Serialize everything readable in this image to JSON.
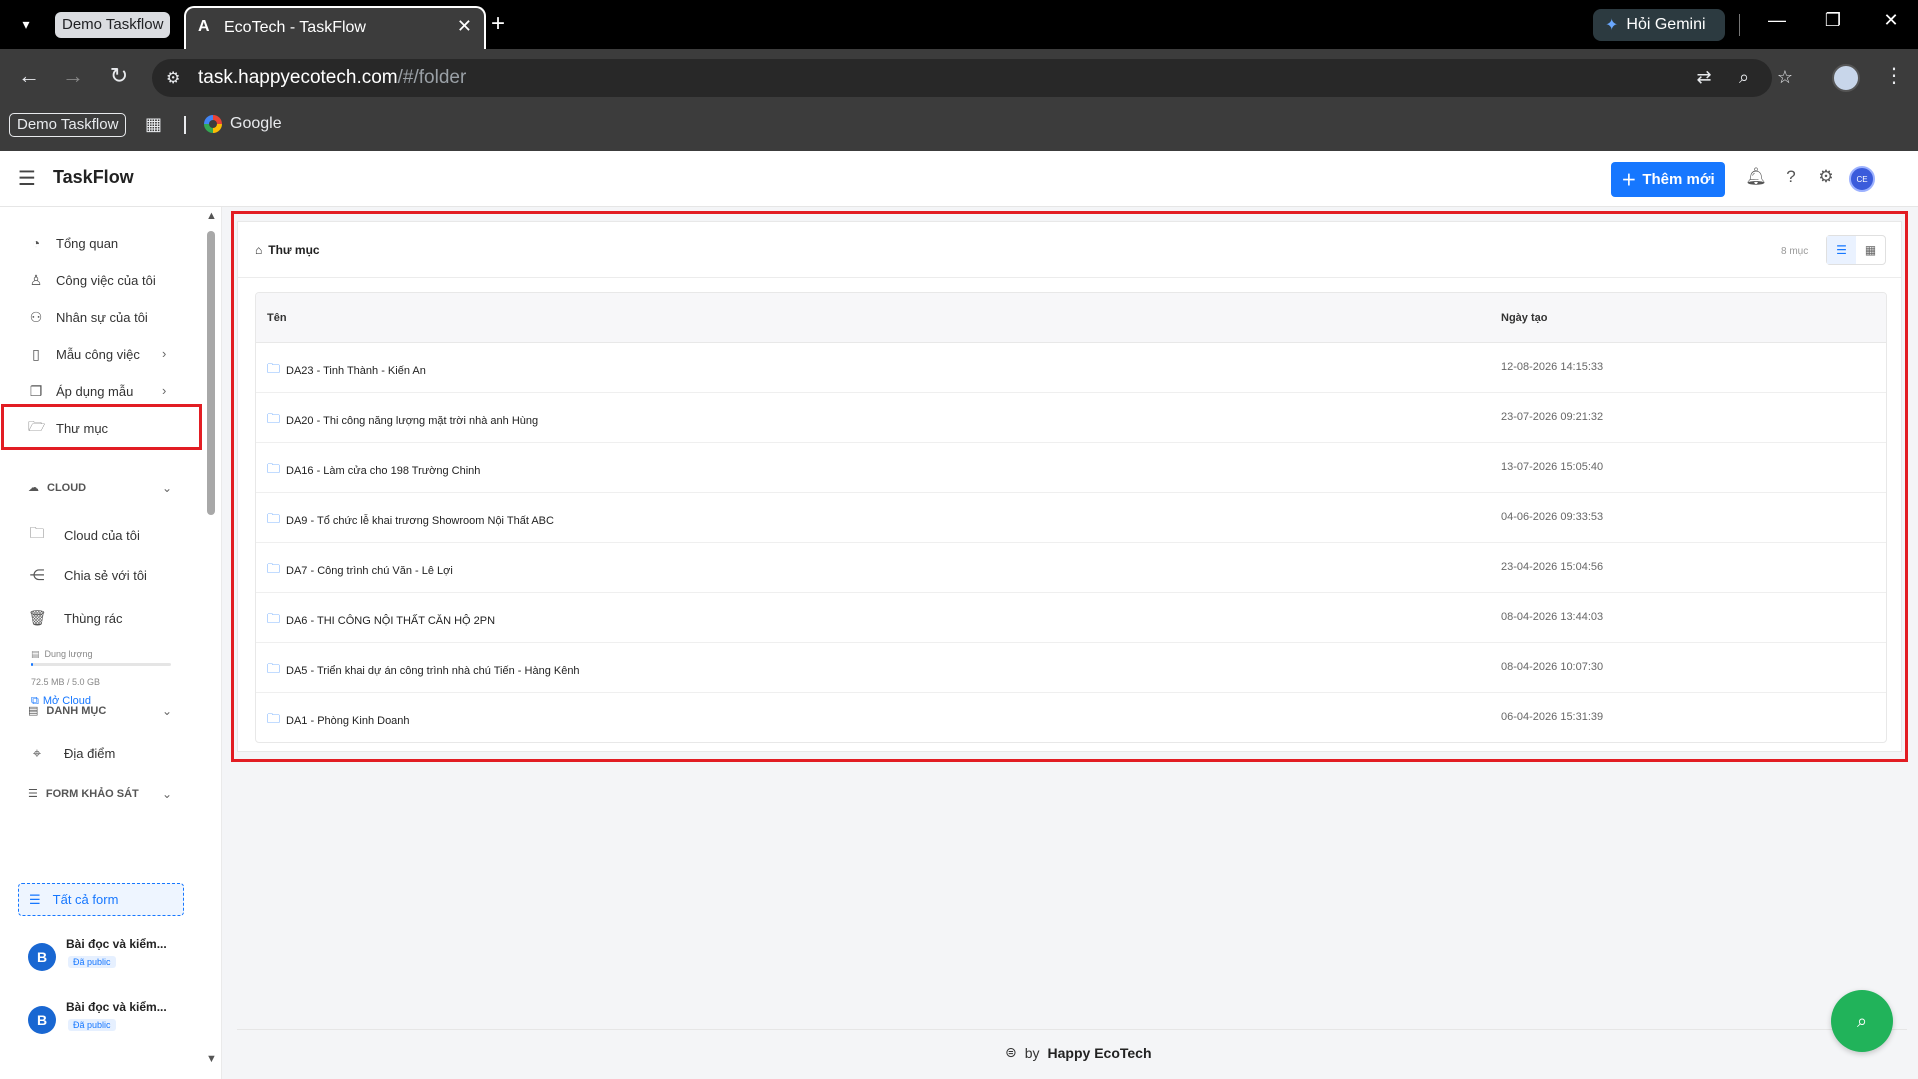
{
  "browser": {
    "tab_group": "Demo Taskflow",
    "active_tab_title": "EcoTech - TaskFlow",
    "new_tab": "+",
    "gemini_label": "Hỏi Gemini",
    "url_host": "task.happyecotech.com",
    "url_path": "/#/folder",
    "bookmark_chip": "Demo Taskflow",
    "bookmark_google": "Google"
  },
  "header": {
    "app_title": "TaskFlow",
    "add_button": "Thêm mới",
    "avatar_initials": "CE"
  },
  "sidebar": {
    "nav": [
      {
        "label": "Tổng quan",
        "icon": "dashboard-icon"
      },
      {
        "label": "Công việc của tôi",
        "icon": "user-icon"
      },
      {
        "label": "Nhân sự của tôi",
        "icon": "team-icon"
      },
      {
        "label": "Mẫu công việc",
        "icon": "file-icon"
      },
      {
        "label": "Áp dụng mẫu",
        "icon": "copy-icon"
      },
      {
        "label": "Thư mục",
        "icon": "folder-open-icon"
      }
    ],
    "cloud": {
      "heading": "CLOUD",
      "items": [
        {
          "label": "Cloud của tôi",
          "icon": "folder-icon"
        },
        {
          "label": "Chia sẻ với tôi",
          "icon": "share-icon"
        },
        {
          "label": "Thùng rác",
          "icon": "trash-icon"
        }
      ],
      "storage_label": "Dung lượng",
      "storage_text": "72.5 MB / 5.0 GB",
      "storage_fraction": 0.014,
      "open_cloud": "Mở Cloud"
    },
    "category": {
      "heading": "DANH MỤC",
      "items": [
        {
          "label": "Địa điểm",
          "icon": "location-icon"
        }
      ]
    },
    "forms": {
      "heading": "FORM KHẢO SÁT",
      "all_forms": "Tất cả form",
      "items": [
        {
          "avatar": "B",
          "title": "Bài đọc và kiểm...",
          "badge": "Đã public"
        },
        {
          "avatar": "B",
          "title": "Bài đọc và kiểm...",
          "badge": "Đã public"
        }
      ]
    }
  },
  "main": {
    "breadcrumb": "Thư mục",
    "count": "8 mục",
    "columns": {
      "name": "Tên",
      "created": "Ngày tạo"
    },
    "rows": [
      {
        "name": "DA23 - Tinh Thành - Kiến An",
        "date": "12-08-2026 14:15:33"
      },
      {
        "name": "DA20 - Thi công năng lượng mặt trời nhà anh Hùng",
        "date": "23-07-2026 09:21:32"
      },
      {
        "name": "DA16 - Làm cửa cho 198 Trường Chinh",
        "date": "13-07-2026 15:05:40"
      },
      {
        "name": "DA9 - Tổ chức lễ khai trương Showroom Nội Thất ABC",
        "date": "04-06-2026 09:33:53"
      },
      {
        "name": "DA7 - Công trình chú Văn - Lê Lợi",
        "date": "23-04-2026 15:04:56"
      },
      {
        "name": "DA6 - THI CÔNG NỘI THẤT CĂN HỘ 2PN",
        "date": "08-04-2026 13:44:03"
      },
      {
        "name": "DA5 - Triển khai dự án công trình nhà chú Tiến - Hàng Kênh",
        "date": "08-04-2026 10:07:30"
      },
      {
        "name": "DA1 - Phòng Kinh Doanh",
        "date": "06-04-2026 15:31:39"
      }
    ]
  },
  "footer": {
    "by": "by",
    "brand": "Happy EcoTech"
  },
  "colors": {
    "accent": "#1677ff",
    "highlight": "#e21d23",
    "fab": "#21b35a"
  }
}
